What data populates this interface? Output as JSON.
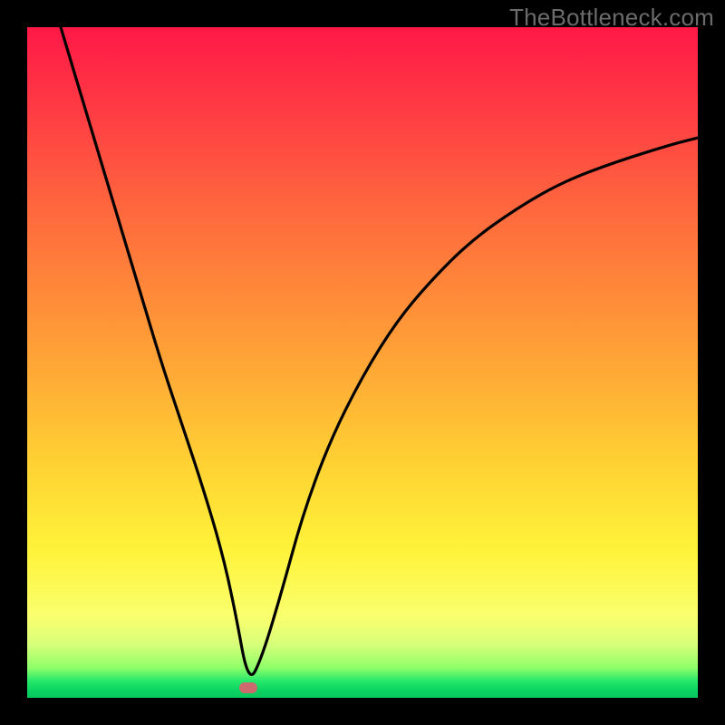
{
  "watermark": "TheBottleneck.com",
  "colors": {
    "frame": "#000000",
    "curve": "#000000",
    "marker": "#cc6a6e",
    "gradient_stops": [
      "#ff1846",
      "#ff3a44",
      "#ff6a3d",
      "#ffa536",
      "#ffd433",
      "#fff33a",
      "#f9ff6e",
      "#d8ff7a",
      "#8fff6a",
      "#25e86a",
      "#09d162",
      "#07c85e"
    ]
  },
  "chart_data": {
    "type": "line",
    "title": "",
    "xlabel": "",
    "ylabel": "",
    "xlim": [
      0,
      100
    ],
    "ylim": [
      0,
      100
    ],
    "grid": false,
    "legend": false,
    "annotations": [
      {
        "name": "minimum-marker",
        "x": 33,
        "y": 1.5
      }
    ],
    "series": [
      {
        "name": "bottleneck-curve",
        "x": [
          5,
          8,
          11,
          14,
          17,
          20,
          23,
          26,
          29,
          31,
          33,
          35,
          38,
          41,
          45,
          50,
          55,
          60,
          66,
          73,
          80,
          88,
          96,
          100
        ],
        "y": [
          100,
          90,
          80,
          70,
          60,
          50,
          41,
          32,
          22,
          13,
          2,
          6,
          16,
          27,
          38,
          48,
          56,
          62,
          68,
          73,
          77,
          80,
          82.5,
          83.5
        ]
      }
    ]
  }
}
